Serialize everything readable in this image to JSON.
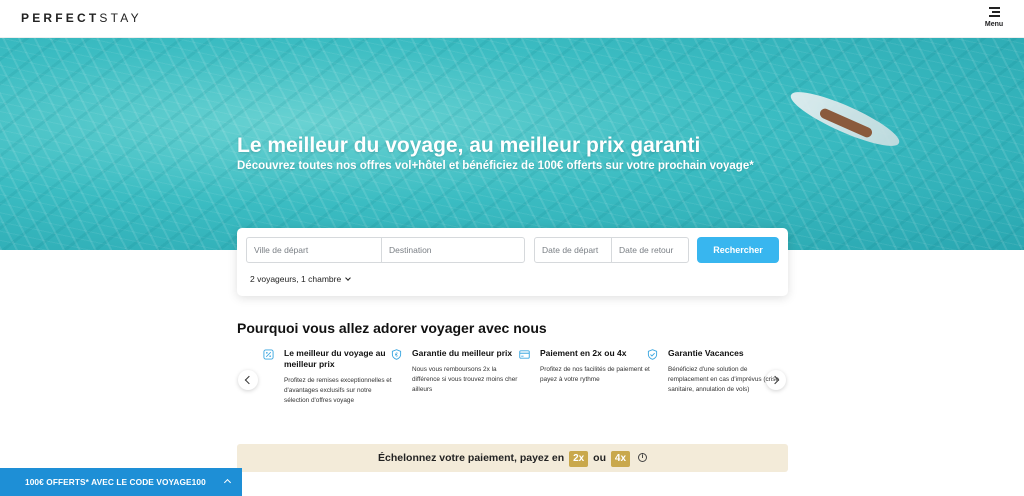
{
  "header": {
    "logo_part1": "PERFECT",
    "logo_part2": "STAY",
    "menu_label": "Menu"
  },
  "hero": {
    "title": "Le meilleur du voyage, au meilleur prix garanti",
    "subtitle": "Découvrez toutes nos offres vol+hôtel et bénéficiez de 100€ offerts sur votre prochain voyage*"
  },
  "search": {
    "departure_placeholder": "Ville de départ",
    "destination_placeholder": "Destination",
    "date_start_placeholder": "Date de départ",
    "date_return_placeholder": "Date de retour",
    "button_label": "Rechercher",
    "travellers": "2 voyageurs, 1 chambre"
  },
  "why": {
    "title": "Pourquoi vous allez adorer voyager avec nous",
    "features": [
      {
        "icon": "discount-tag-icon",
        "title": "Le meilleur du voyage au meilleur prix",
        "desc": "Profitez de remises exceptionnelles et d'avantages exclusifs sur notre sélection d'offres voyage"
      },
      {
        "icon": "euro-shield-icon",
        "title": "Garantie du meilleur prix",
        "desc": "Nous vous remboursons 2x la différence si vous trouvez moins cher ailleurs"
      },
      {
        "icon": "credit-card-icon",
        "title": "Paiement en 2x ou 4x",
        "desc": "Profitez de nos facilités de paiement et payez à votre rythme"
      },
      {
        "icon": "holiday-shield-icon",
        "title": "Garantie Vacances",
        "desc": "Bénéficiez d'une solution de remplacement en cas d'imprévus (crise sanitaire, annulation de vols)"
      }
    ]
  },
  "payment": {
    "text": "Échelonnez votre paiement, payez en",
    "option1": "2x",
    "connector": "ou",
    "option2": "4x",
    "info_glyph": "i"
  },
  "promo": {
    "text": "100€ OFFERTS* AVEC LE CODE VOYAGE100"
  },
  "colors": {
    "accent": "#38b6ef",
    "promo_bar": "#1e8fd6",
    "banner_bg": "#f3ebd9",
    "badge": "#c9a84c"
  }
}
